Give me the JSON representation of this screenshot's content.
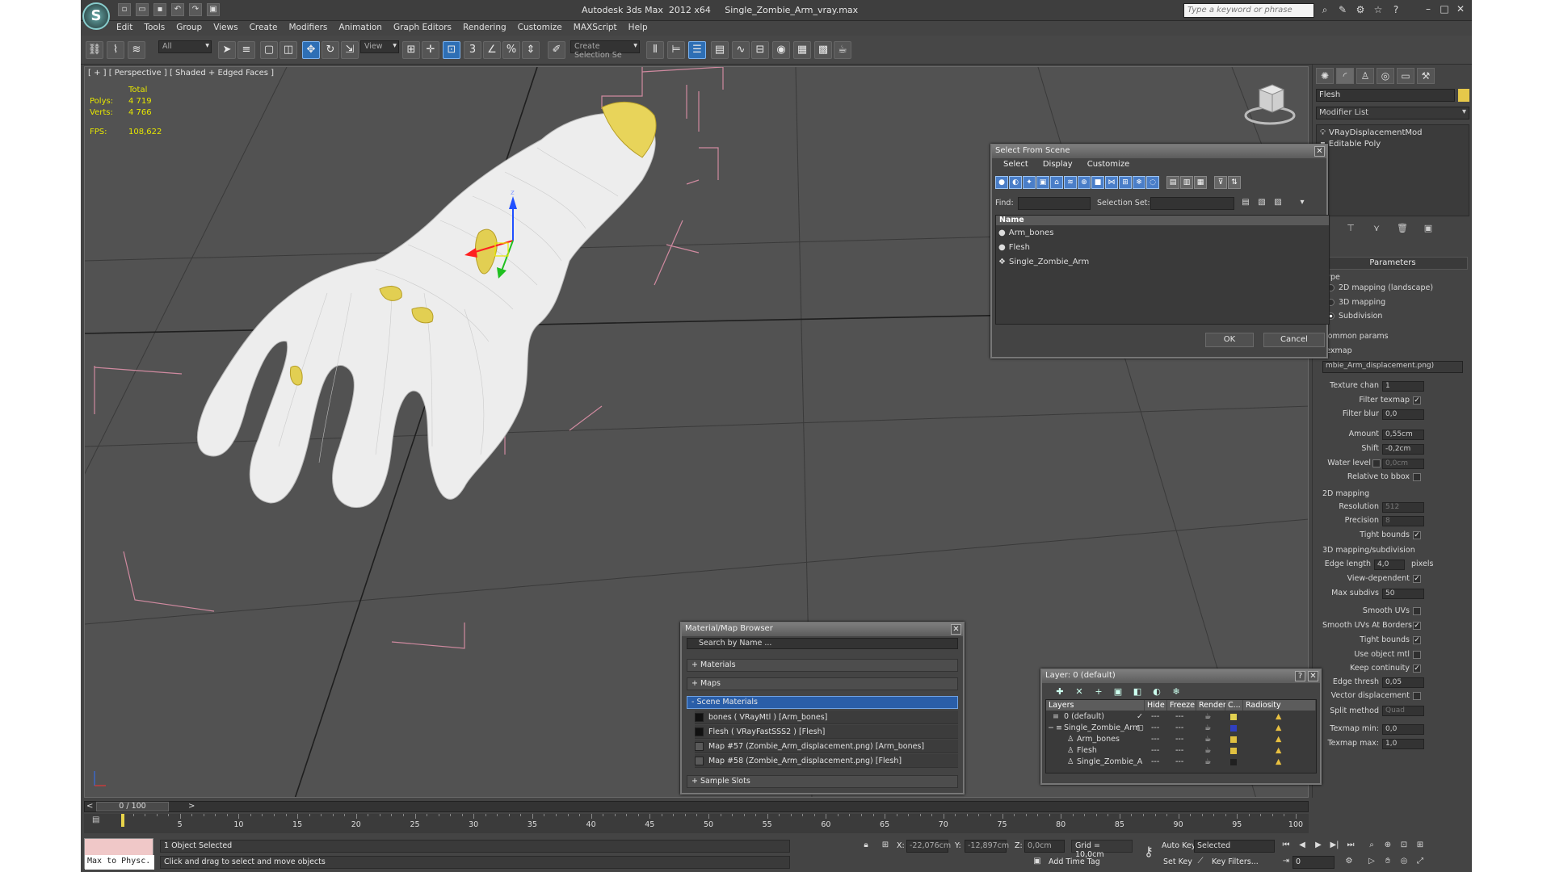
{
  "app": {
    "title": "Autodesk 3ds Max  2012 x64     Single_Zombie_Arm_vray.max",
    "search_placeholder": "Type a keyword or phrase"
  },
  "menu": [
    "Edit",
    "Tools",
    "Group",
    "Views",
    "Create",
    "Modifiers",
    "Animation",
    "Graph Editors",
    "Rendering",
    "Customize",
    "MAXScript",
    "Help"
  ],
  "toolbar": {
    "filter_value": "All",
    "refcoord_value": "View",
    "selection_set": "Create Selection Se"
  },
  "viewport": {
    "label": "[ + ] [ Perspective ] [ Shaded + Edged Faces ]",
    "stats_header": "Total",
    "polys_label": "Polys:",
    "polys_value": "4 719",
    "verts_label": "Verts:",
    "verts_value": "4 766",
    "fps_label": "FPS:",
    "fps_value": "108,622"
  },
  "command_panel": {
    "object_name": "Flesh",
    "modifier_list": "Modifier List",
    "stack": [
      "VRayDisplacementMod",
      "Editable Poly"
    ],
    "parameters_title": "Parameters",
    "type_label": "Type",
    "type_options": [
      "2D mapping (landscape)",
      "3D mapping",
      "Subdivision"
    ],
    "type_selected": "Subdivision",
    "common_params": "Common params",
    "texmap_label": "Texmap",
    "texmap_value": "mbie_Arm_displacement.png)",
    "texture_chan_label": "Texture chan",
    "texture_chan_value": "1",
    "filter_texmap_label": "Filter texmap",
    "filter_blur_label": "Filter blur",
    "filter_blur_value": "0,0",
    "amount_label": "Amount",
    "amount_value": "0,55cm",
    "shift_label": "Shift",
    "shift_value": "-0,2cm",
    "water_level_label": "Water level",
    "water_level_value": "0,0cm",
    "relative_bbox_label": "Relative to bbox",
    "mapping2d_label": "2D mapping",
    "resolution_label": "Resolution",
    "resolution_value": "512",
    "precision_label": "Precision",
    "precision_value": "8",
    "tight_bounds_label": "Tight bounds",
    "mapping3d_label": "3D mapping/subdivision",
    "edge_length_label": "Edge length",
    "edge_length_value": "4,0",
    "pixels_label": "pixels",
    "view_dependent_label": "View-dependent",
    "max_subdivs_label": "Max subdivs",
    "max_subdivs_value": "50",
    "smooth_uvs_label": "Smooth UVs",
    "smooth_uvs_borders_label": "Smooth UVs At Borders",
    "tight_bounds2_label": "Tight bounds",
    "use_object_mtl_label": "Use object mtl",
    "keep_continuity_label": "Keep continuity",
    "edge_thresh_label": "Edge thresh",
    "edge_thresh_value": "0,05",
    "vector_disp_label": "Vector displacement",
    "split_method_label": "Split method",
    "split_method_value": "Quad",
    "texmap_min_label": "Texmap min:",
    "texmap_min_value": "0,0",
    "texmap_max_label": "Texmap max:",
    "texmap_max_value": "1,0"
  },
  "select_from_scene": {
    "title": "Select From Scene",
    "menu": [
      "Select",
      "Display",
      "Customize"
    ],
    "find_label": "Find:",
    "selection_set_label": "Selection Set:",
    "column_name": "Name",
    "items": [
      "Arm_bones",
      "Flesh",
      "Single_Zombie_Arm"
    ],
    "ok": "OK",
    "cancel": "Cancel"
  },
  "material_browser": {
    "title": "Material/Map Browser",
    "search": "Search by Name ...",
    "sections": [
      "+ Materials",
      "+ Maps",
      "- Scene Materials"
    ],
    "items": [
      {
        "text": "bones  ( VRayMtl )  [Arm_bones]",
        "swatch": "#111111"
      },
      {
        "text": "Flesh  ( VRayFastSSS2 )  [Flesh]",
        "swatch": "#111111"
      },
      {
        "text": "Map #57 (Zombie_Arm_displacement.png)  [Arm_bones]",
        "swatch": "#5a5a5a"
      },
      {
        "text": "Map #58 (Zombie_Arm_displacement.png)  [Flesh]",
        "swatch": "#5a5a5a"
      }
    ],
    "sample_slots": "+ Sample Slots"
  },
  "layer_dialog": {
    "title": "Layer: 0 (default)",
    "columns": [
      "Layers",
      "Hide",
      "Freeze",
      "Render",
      "C...",
      "Radiosity"
    ],
    "rows": [
      {
        "name": "0 (default)",
        "color": "#e0d050",
        "indent": 0
      },
      {
        "name": "Single_Zombie_Arm",
        "color": "#3040c0",
        "indent": 0
      },
      {
        "name": "Arm_bones",
        "color": "#e0c040",
        "indent": 1
      },
      {
        "name": "Flesh",
        "color": "#e0c040",
        "indent": 1
      },
      {
        "name": "Single_Zombie_A",
        "color": "#202020",
        "indent": 1
      }
    ]
  },
  "timeline": {
    "frame": "0 / 100",
    "ticks": [
      "5",
      "10",
      "15",
      "20",
      "25",
      "30",
      "35",
      "40",
      "45",
      "50",
      "55",
      "60",
      "65",
      "70",
      "75",
      "80",
      "85",
      "90",
      "95",
      "100"
    ]
  },
  "status": {
    "maxscript": "Max to Physc.",
    "selected": "1 Object Selected",
    "prompt": "Click and drag to select and move objects",
    "x_label": "X:",
    "x_value": "-22,076cm",
    "y_label": "Y:",
    "y_value": "-12,897cm",
    "z_label": "Z:",
    "z_value": "0,0cm",
    "grid": "Grid = 10,0cm",
    "add_time_tag": "Add Time Tag",
    "auto_key": "Auto Key",
    "set_key": "Set Key",
    "selected_dd": "Selected",
    "key_filters": "Key Filters...",
    "frame_value": "0"
  }
}
